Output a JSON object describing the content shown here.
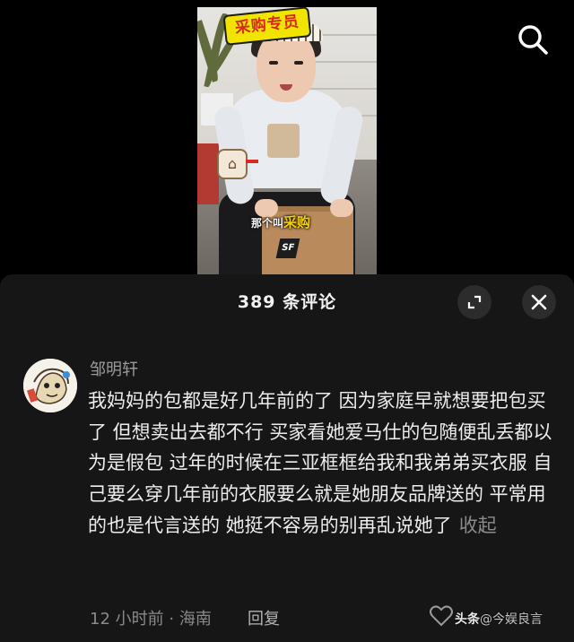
{
  "video": {
    "banner_text": "采购专员",
    "box_logo": "SF",
    "subtitle_prefix": "那个叫",
    "subtitle_highlight": "采购",
    "search_icon": "search-icon"
  },
  "comments_panel": {
    "title": "389 条评论",
    "expand_icon": "expand-icon",
    "close_icon": "close-icon",
    "comment": {
      "username": "邹明轩",
      "avatar_icon": "avatar-cartoon",
      "text": "我妈妈的包都是好几年前的了 因为家庭早就想要把包买了 但想卖出去都不行 买家看她爱马仕的包随便乱丢都以为是假包 过年的时候在三亚框框给我和我弟弟买衣服 自己要么穿几年前的衣服要么就是她朋友品牌送的 平常用的也是代言送的 她挺不容易的别再乱说她了",
      "collapse_label": "收起",
      "time": "12 小时前",
      "separator": "·",
      "location": "海南",
      "reply_label": "回复",
      "like_icon": "heart-icon"
    }
  },
  "watermark": {
    "brand": "头条",
    "account": "@今娱良言"
  },
  "colors": {
    "background": "#000000",
    "sheet": "#161616",
    "text_primary": "#ededed",
    "text_secondary": "#8a8a8a",
    "banner_yellow": "#f0e400",
    "banner_red": "#d6281b"
  }
}
